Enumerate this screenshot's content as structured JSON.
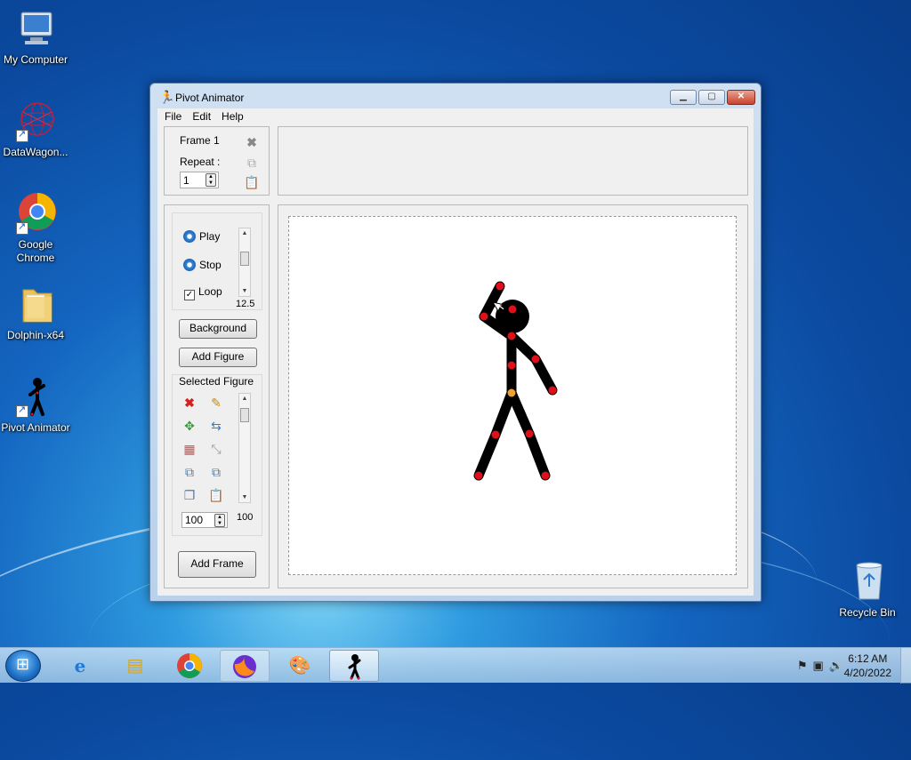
{
  "desktop": {
    "icons": [
      {
        "label": "My Computer",
        "icon": "computer-icon"
      },
      {
        "label": "DataWagon...",
        "icon": "network-sphere-icon"
      },
      {
        "label": "Google Chrome",
        "icon": "chrome-icon"
      },
      {
        "label": "Dolphin-x64",
        "icon": "folder-icon"
      },
      {
        "label": "Pivot Animator",
        "icon": "stickman-icon"
      },
      {
        "label": "Recycle Bin",
        "icon": "recycle-bin-icon"
      }
    ]
  },
  "window": {
    "title": "Pivot Animator",
    "menu": [
      "File",
      "Edit",
      "Help"
    ],
    "frame_panel": {
      "frame_label": "Frame 1",
      "repeat_label": "Repeat :",
      "repeat_value": "1"
    },
    "playback": {
      "play_label": "Play",
      "stop_label": "Stop",
      "loop_label": "Loop",
      "loop_checked": true,
      "speed_value": "12.5"
    },
    "buttons": {
      "background": "Background",
      "add_figure": "Add Figure",
      "add_frame": "Add Frame"
    },
    "selected_figure": {
      "heading": "Selected Figure",
      "scale_value": "100",
      "opacity_value": "100"
    }
  },
  "taskbar": {
    "apps": [
      {
        "icon": "internet-explorer-icon"
      },
      {
        "icon": "file-explorer-icon"
      },
      {
        "icon": "chrome-icon"
      },
      {
        "icon": "firefox-icon"
      },
      {
        "icon": "paint-icon"
      },
      {
        "icon": "pivot-animator-icon",
        "active": true
      }
    ],
    "time": "6:12 AM",
    "date": "4/20/2022"
  },
  "colors": {
    "joint": "#e0101a",
    "root_joint": "#f0a030",
    "figure": "#000000"
  }
}
